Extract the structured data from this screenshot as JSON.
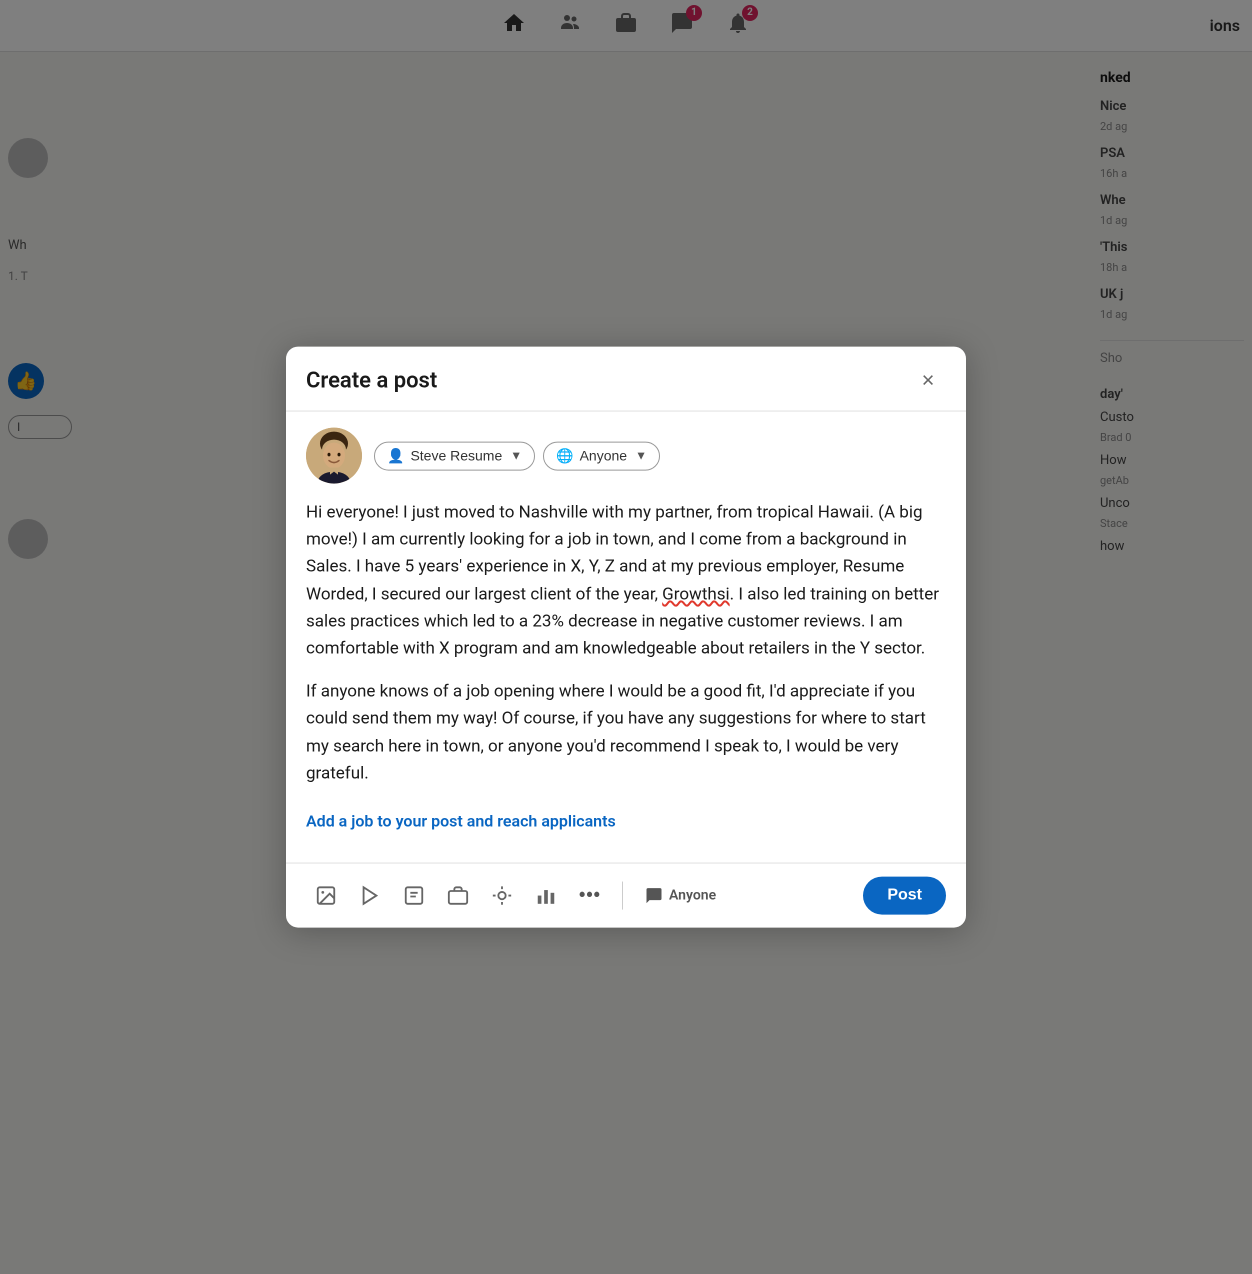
{
  "nav": {
    "home_icon": "🏠",
    "people_icon": "👥",
    "jobs_icon": "💼",
    "messages_icon": "💬",
    "messages_badge": "1",
    "notifications_icon": "🔔",
    "notifications_badge": "2",
    "partial_text": "ions"
  },
  "modal": {
    "title": "Create a post",
    "close_label": "×",
    "user": {
      "name": "Steve Resume",
      "audience": "Anyone"
    },
    "post_paragraph1": "Hi everyone! I just moved to Nashville with my partner, from tropical Hawaii. (A big move!) I am currently looking for a job in town, and I come from a background in Sales. I have 5 years' experience in X, Y, Z and at my previous employer, Resume Worded, I secured our largest client of the year, Growthsi. I also led training on better sales practices which led to a 23% decrease in negative customer reviews. I am comfortable with X program and am knowledgeable about retailers in the Y sector.",
    "post_paragraph2": "If anyone knows of a job opening where I would be a good fit, I'd appreciate if you could send them my way! Of course, if you have any suggestions for where to start my search here in town, or anyone you'd recommend I speak to, I would be very grateful.",
    "add_job_text": "Add a job to your post and reach applicants",
    "footer": {
      "photo_icon": "🖼",
      "video_icon": "▶",
      "document_icon": "📋",
      "job_icon": "💼",
      "celebrate_icon": "⭐",
      "poll_icon": "📊",
      "more_icon": "•••",
      "audience_label": "Anyone",
      "post_button": "Post"
    },
    "misspelled_word": "Growthsi"
  },
  "background": {
    "right_items": [
      {
        "label": "Nice",
        "time": "2d ag"
      },
      {
        "label": "PSA",
        "time": "16h a"
      },
      {
        "label": "Whe",
        "time": "1d ag"
      },
      {
        "label": "'This",
        "time": "18h a"
      },
      {
        "label": "UK j",
        "time": "1d ag"
      },
      {
        "label": "Sho",
        "time": ""
      },
      {
        "label": "day'",
        "time": ""
      },
      {
        "label": "Custo",
        "time": ""
      },
      {
        "label": "How",
        "time": ""
      },
      {
        "label": "Unco",
        "time": ""
      },
      {
        "label": "how",
        "time": ""
      }
    ]
  }
}
